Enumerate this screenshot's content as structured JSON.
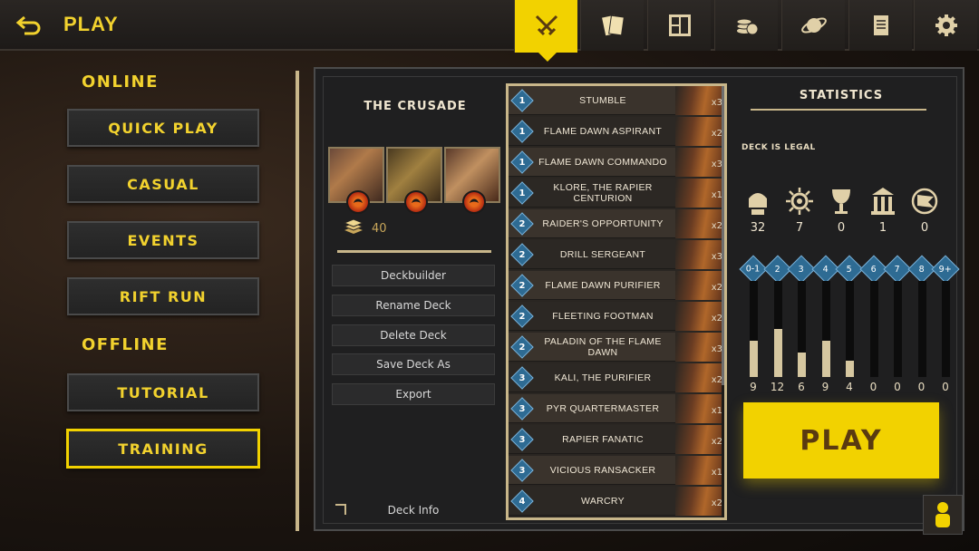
{
  "header": {
    "title": "PLAY",
    "back_icon": "undo-arrow-icon",
    "tabs": [
      {
        "icon": "crossed-swords-icon",
        "active": true
      },
      {
        "icon": "cards-icon",
        "active": false
      },
      {
        "icon": "board-layout-icon",
        "active": false
      },
      {
        "icon": "coins-icon",
        "active": false
      },
      {
        "icon": "planet-icon",
        "active": false
      },
      {
        "icon": "scroll-icon",
        "active": false
      },
      {
        "icon": "gear-icon",
        "active": false
      }
    ]
  },
  "menu": {
    "online_label": "ONLINE",
    "offline_label": "OFFLINE",
    "quick_play": "QUICK PLAY",
    "casual": "CASUAL",
    "events": "EVENTS",
    "rift_run": "RIFT RUN",
    "tutorial": "TUTORIAL",
    "training": "TRAINING",
    "selected": "TRAINING"
  },
  "deck": {
    "name": "THE CRUSADE",
    "card_count": "40",
    "actions": {
      "deckbuilder": "Deckbuilder",
      "rename": "Rename Deck",
      "delete": "Delete Deck",
      "save_as": "Save Deck As",
      "export": "Export"
    },
    "info": "Deck Info"
  },
  "cards": [
    {
      "cost": "1",
      "name": "STUMBLE",
      "qty": "x3"
    },
    {
      "cost": "1",
      "name": "FLAME DAWN ASPIRANT",
      "qty": "x2"
    },
    {
      "cost": "1",
      "name": "FLAME DAWN COMMANDO",
      "qty": "x3"
    },
    {
      "cost": "1",
      "name": "KLORE, THE RAPIER CENTURION",
      "qty": "x1"
    },
    {
      "cost": "2",
      "name": "RAIDER'S OPPORTUNITY",
      "qty": "x2"
    },
    {
      "cost": "2",
      "name": "DRILL SERGEANT",
      "qty": "x3"
    },
    {
      "cost": "2",
      "name": "FLAME DAWN PURIFIER",
      "qty": "x2"
    },
    {
      "cost": "2",
      "name": "FLEETING FOOTMAN",
      "qty": "x2"
    },
    {
      "cost": "2",
      "name": "PALADIN OF THE FLAME DAWN",
      "qty": "x3"
    },
    {
      "cost": "3",
      "name": "KALI, THE PURIFIER",
      "qty": "x2"
    },
    {
      "cost": "3",
      "name": "PYR QUARTERMASTER",
      "qty": "x1"
    },
    {
      "cost": "3",
      "name": "RAPIER FANATIC",
      "qty": "x2"
    },
    {
      "cost": "3",
      "name": "VICIOUS RANSACKER",
      "qty": "x1"
    },
    {
      "cost": "4",
      "name": "WARCRY",
      "qty": "x2"
    }
  ],
  "statistics": {
    "title": "STATISTICS",
    "legal": "DECK IS LEGAL",
    "types": [
      {
        "icon": "soldier-helmet-icon",
        "value": "32"
      },
      {
        "icon": "sun-burst-icon",
        "value": "7"
      },
      {
        "icon": "chalice-icon",
        "value": "0"
      },
      {
        "icon": "temple-icon",
        "value": "1"
      },
      {
        "icon": "banner-flag-icon",
        "value": "0"
      }
    ],
    "curve": [
      {
        "label": "0-1",
        "count": 9
      },
      {
        "label": "2",
        "count": 12
      },
      {
        "label": "3",
        "count": 6
      },
      {
        "label": "4",
        "count": 9
      },
      {
        "label": "5",
        "count": 4
      },
      {
        "label": "6",
        "count": 0
      },
      {
        "label": "7",
        "count": 0
      },
      {
        "label": "8",
        "count": 0
      },
      {
        "label": "9+",
        "count": 0
      }
    ]
  },
  "play_button": "PLAY",
  "avatar_icon": "person-icon"
}
